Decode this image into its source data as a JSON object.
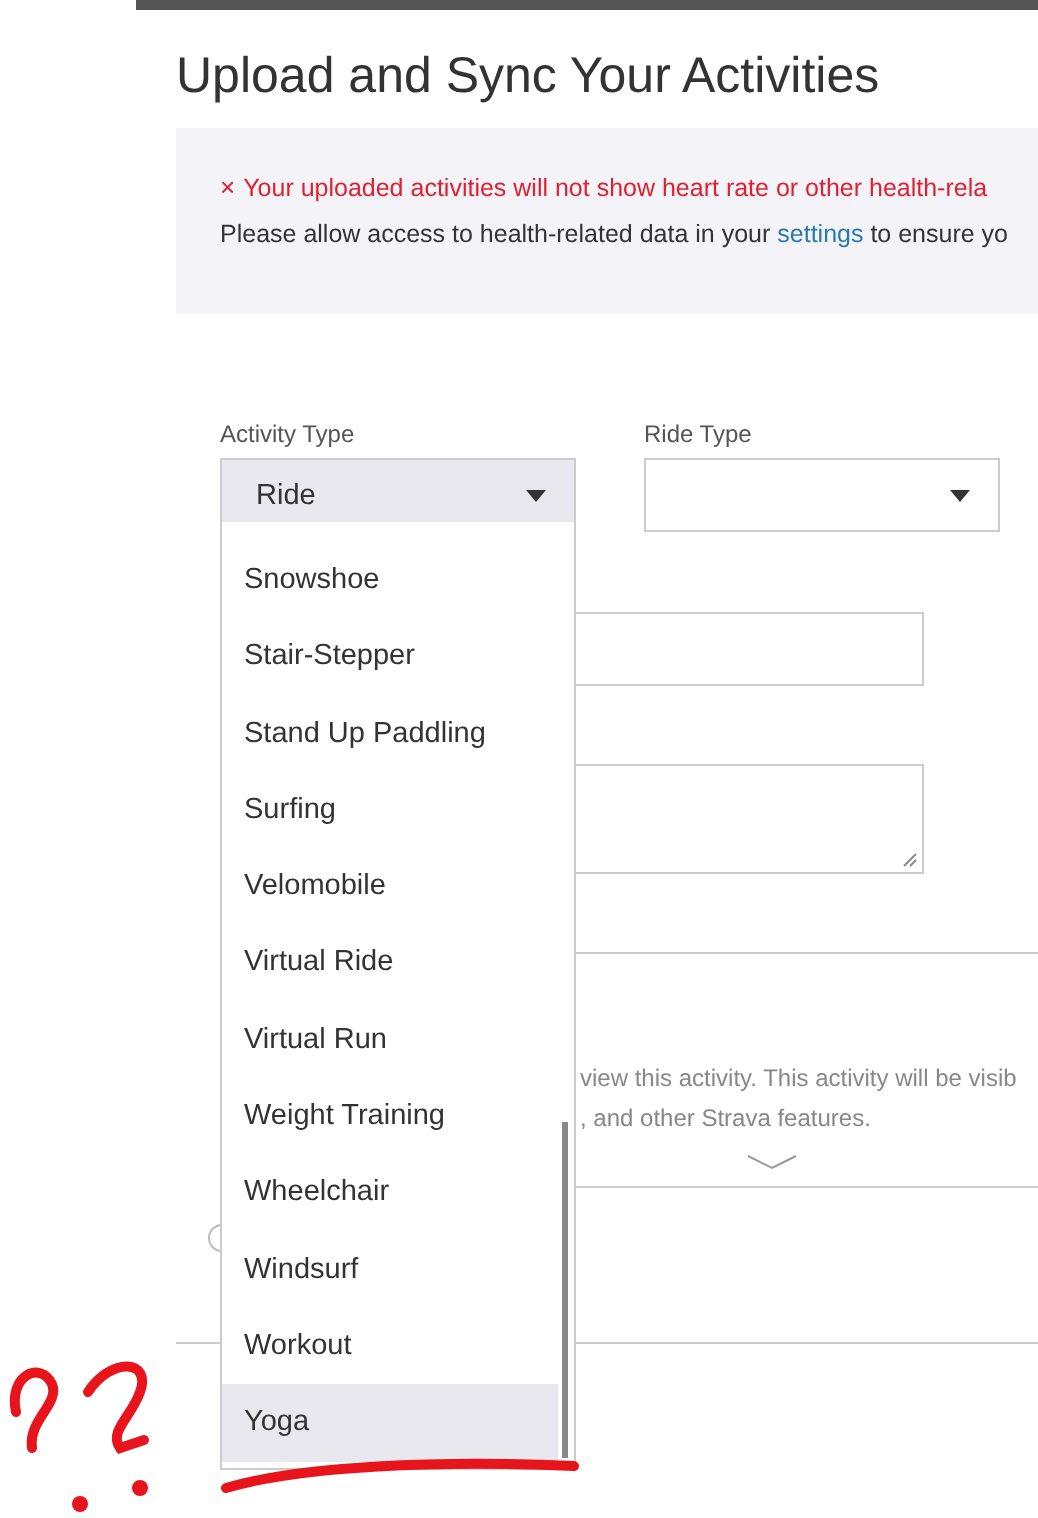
{
  "page": {
    "title": "Upload and Sync Your Activities"
  },
  "alert": {
    "icon": "×",
    "error": "Your uploaded activities will not show heart rate or other health-rela",
    "message_before": "Please allow access to health-related data in your",
    "link": "settings",
    "message_after": "to ensure yo"
  },
  "form": {
    "activity_type": {
      "label": "Activity Type",
      "value": "Ride",
      "open": true
    },
    "ride_type": {
      "label": "Ride Type"
    }
  },
  "dropdown": {
    "options": [
      {
        "label": "Snowshoe",
        "selected": false
      },
      {
        "label": "Stair-Stepper",
        "selected": false
      },
      {
        "label": "Stand Up Paddling",
        "selected": false
      },
      {
        "label": "Surfing",
        "selected": false
      },
      {
        "label": "Velomobile",
        "selected": false
      },
      {
        "label": "Virtual Ride",
        "selected": false
      },
      {
        "label": "Virtual Run",
        "selected": false
      },
      {
        "label": "Weight Training",
        "selected": false
      },
      {
        "label": "Wheelchair",
        "selected": false
      },
      {
        "label": "Windsurf",
        "selected": false
      },
      {
        "label": "Workout",
        "selected": false
      },
      {
        "label": "Yoga",
        "selected": true
      }
    ]
  },
  "radio": {
    "selected": false
  },
  "visibility_note": [
    "view this activity. This activity will be visib",
    ", and other Strava features."
  ]
}
